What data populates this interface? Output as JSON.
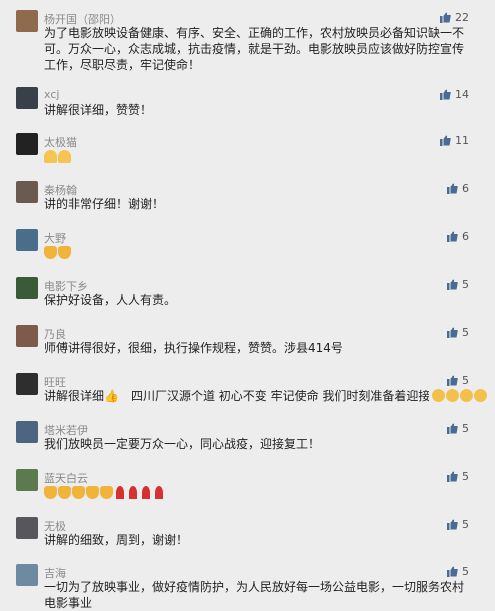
{
  "comments": [
    {
      "avatar_color": "#8f6a4e",
      "name": "杨开国（邵阳）",
      "likes": "22",
      "text": "为了电影放映设备健康、有序、安全、正确的工作，农村放映员必备知识缺一不可。万众一心，众志成城，抗击疫情，就是干劲。电影放映员应该做好防控宣传工作，尽职尽责，牢记使命！"
    },
    {
      "avatar_color": "#3a4048",
      "name": "xcj",
      "likes": "14",
      "text": "讲解很详细，赞赞！"
    },
    {
      "avatar_color": "#222222",
      "name": "太极猫",
      "likes": "11",
      "text": "",
      "emoji": [
        "pray",
        "pray"
      ]
    },
    {
      "avatar_color": "#6b5a4f",
      "name": "秦杨翰",
      "likes": "6",
      "text": "讲的非常仔细！谢谢！"
    },
    {
      "avatar_color": "#4a6d8c",
      "name": "大野",
      "likes": "6",
      "text": "",
      "emoji": [
        "thumb",
        "thumb"
      ]
    },
    {
      "avatar_color": "#3a5a3a",
      "name": "电影下乡",
      "likes": "5",
      "text": "保护好设备，人人有责。"
    },
    {
      "avatar_color": "#7d5a4a",
      "name": "乃良",
      "likes": "5",
      "text": "师傅讲得很好，很细，执行操作规程，赞赞。涉县414号"
    },
    {
      "avatar_color": "#2e2e2e",
      "name": "旺旺",
      "likes": "5",
      "text": "讲解很详细👍　四川厂汉源个道 初心不变 牢记使命 我们时刻准备着迎接复工！",
      "emoji_tail": [
        "face",
        "face",
        "face",
        "face"
      ]
    },
    {
      "avatar_color": "#4c6580",
      "name": "塔米若伊",
      "likes": "5",
      "text": "我们放映员一定要万众一心，同心战疫，迎接复工！"
    },
    {
      "avatar_color": "#5c7a4e",
      "name": "蓝天白云",
      "likes": "5",
      "text": "",
      "emoji": [
        "thumb",
        "thumb",
        "thumb",
        "thumb",
        "thumb",
        "rose",
        "rose",
        "rose",
        "rose"
      ]
    },
    {
      "avatar_color": "#56565c",
      "name": "无极",
      "likes": "5",
      "text": "讲解的细致，周到，谢谢！"
    },
    {
      "avatar_color": "#6d8aa0",
      "name": "吉海",
      "likes": "5",
      "text": "一切为了放映事业，做好疫情防护，为人民放好每一场公益电影，一切服务农村电影事业"
    }
  ]
}
